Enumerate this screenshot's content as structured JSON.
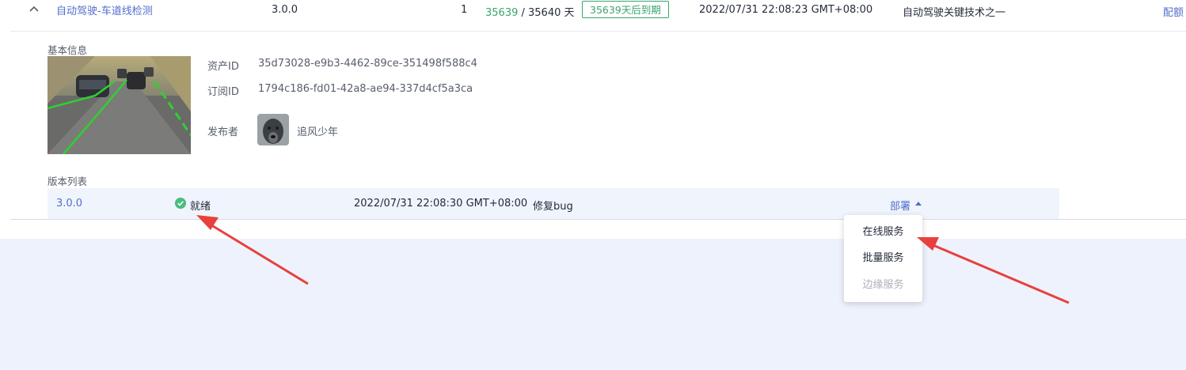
{
  "asset_row": {
    "name": "自动驾驶-车道线检测",
    "version": "3.0.0",
    "count": "1",
    "days_remaining": "35639",
    "days_separator": " / ",
    "days_total": "35640 天",
    "expire_badge": "35639天后到期",
    "timestamp": "2022/07/31 22:08:23 GMT+08:00",
    "description": "自动驾驶关键技术之一",
    "action_label": "配额"
  },
  "basic_info": {
    "section_title": "基本信息",
    "asset_id_label": "资产ID",
    "asset_id_value": "35d73028-e9b3-4462-89ce-351498f588c4",
    "subscription_id_label": "订阅ID",
    "subscription_id_value": "1794c186-fd01-42a8-ae94-337d4cf5a3ca",
    "publisher_label": "发布者",
    "publisher_name": "追风少年"
  },
  "version_list": {
    "section_title": "版本列表",
    "rows": [
      {
        "version": "3.0.0",
        "status": "就绪",
        "timestamp": "2022/07/31 22:08:30 GMT+08:00",
        "note": "修复bug",
        "deploy_label": "部署"
      }
    ]
  },
  "deploy_menu": {
    "items": [
      {
        "label": "在线服务",
        "disabled": false
      },
      {
        "label": "批量服务",
        "disabled": false
      },
      {
        "label": "边缘服务",
        "disabled": true
      }
    ]
  },
  "colors": {
    "link": "#526ecc",
    "success": "#3ba56b",
    "annotation_arrow": "#e8403d",
    "page_background": "#eef2fc"
  },
  "icons": {
    "expand_toggle": "chevron-up-icon",
    "status": "check-circle-icon",
    "dropdown": "caret-up-icon"
  }
}
